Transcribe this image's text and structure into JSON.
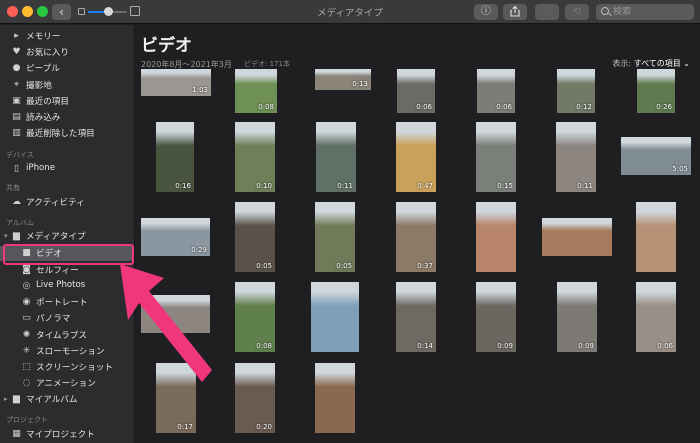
{
  "window": {
    "title": "メディアタイプ"
  },
  "toolbar": {
    "back": "‹",
    "info": "ⓘ",
    "search_placeholder": "検索"
  },
  "sidebar": {
    "items_top": [
      {
        "label": "メモリー",
        "icon": "memories-icon",
        "glyph": "▸"
      },
      {
        "label": "お気に入り",
        "icon": "heart-icon",
        "glyph": "♥"
      },
      {
        "label": "ピープル",
        "icon": "person-icon",
        "glyph": "●"
      },
      {
        "label": "撮影地",
        "icon": "map-pin-icon",
        "glyph": "⌖"
      },
      {
        "label": "最近の項目",
        "icon": "import-icon",
        "glyph": "▣"
      },
      {
        "label": "読み込み",
        "icon": "import-tray-icon",
        "glyph": "▤"
      },
      {
        "label": "最近削除した項目",
        "icon": "trash-icon",
        "glyph": "▥"
      }
    ],
    "section_devices": "デバイス",
    "iphone": "iPhone",
    "section_shared": "共有",
    "activity": "アクティビティ",
    "section_albums": "アルバム",
    "media_types": "メディアタイプ",
    "media_items": [
      {
        "label": "ビデオ",
        "icon": "video-icon",
        "glyph": "■"
      },
      {
        "label": "セルフィー",
        "icon": "selfie-icon",
        "glyph": "◙"
      },
      {
        "label": "Live Photos",
        "icon": "live-photo-icon",
        "glyph": "◎"
      },
      {
        "label": "ポートレート",
        "icon": "portrait-icon",
        "glyph": "◉"
      },
      {
        "label": "パノラマ",
        "icon": "panorama-icon",
        "glyph": "▭"
      },
      {
        "label": "タイムラプス",
        "icon": "timelapse-icon",
        "glyph": "✺"
      },
      {
        "label": "スローモーション",
        "icon": "slowmo-icon",
        "glyph": "✳"
      },
      {
        "label": "スクリーンショット",
        "icon": "screenshot-icon",
        "glyph": "⬚"
      },
      {
        "label": "アニメーション",
        "icon": "animation-icon",
        "glyph": "◌"
      }
    ],
    "my_albums": "マイアルバム",
    "section_projects": "プロジェクト",
    "my_projects": "マイプロジェクト"
  },
  "main": {
    "title": "ビデオ",
    "date_range": "2020年8月〜2021年3月",
    "count": "ビデオ: 171本",
    "view_label": "表示:",
    "view_value": "すべての項目 ⌄",
    "thumbs": [
      {
        "d": "1:03",
        "c": "#9a9792"
      },
      {
        "d": "0:08",
        "c": "#6e8f56"
      },
      {
        "d": "0:13",
        "c": "#8a8479"
      },
      {
        "d": "0:06",
        "c": "#6b6b66"
      },
      {
        "d": "0:06",
        "c": "#7d7c77"
      },
      {
        "d": "0:12",
        "c": "#707a66"
      },
      {
        "d": "0:26",
        "c": "#5e7a4e"
      },
      {
        "d": "0:16",
        "c": "#4a5540"
      },
      {
        "d": "0:10",
        "c": "#6f7f5a"
      },
      {
        "d": "0:11",
        "c": "#5f7066"
      },
      {
        "d": "0:47",
        "c": "#c9a15a"
      },
      {
        "d": "0:15",
        "c": "#7b7f7a"
      },
      {
        "d": "0:11",
        "c": "#8d8680"
      },
      {
        "d": "5:05",
        "c": "#7f8c93"
      },
      {
        "d": "0:29",
        "c": "#8a96a0"
      },
      {
        "d": "0:05",
        "c": "#5a5248"
      },
      {
        "d": "0:05",
        "c": "#707a58"
      },
      {
        "d": "0:37",
        "c": "#8b7a66"
      },
      {
        "d": "",
        "c": "#b8846a"
      },
      {
        "d": "",
        "c": "#a67a5c"
      },
      {
        "d": "",
        "c": "#b59175"
      },
      {
        "d": "",
        "c": "#8c8580"
      },
      {
        "d": "0:08",
        "c": "#5f7f4c"
      },
      {
        "d": "",
        "c": "#7f9fb8"
      },
      {
        "d": "0:14",
        "c": "#6e6a63"
      },
      {
        "d": "0:09",
        "c": "#6b6760"
      },
      {
        "d": "0:09",
        "c": "#7d7a76"
      },
      {
        "d": "0:06",
        "c": "#9a8f86"
      },
      {
        "d": "0:17",
        "c": "#7a6a5c"
      },
      {
        "d": "0:20",
        "c": "#6a5a50"
      },
      {
        "d": "",
        "c": "#8a6a4e"
      }
    ]
  }
}
